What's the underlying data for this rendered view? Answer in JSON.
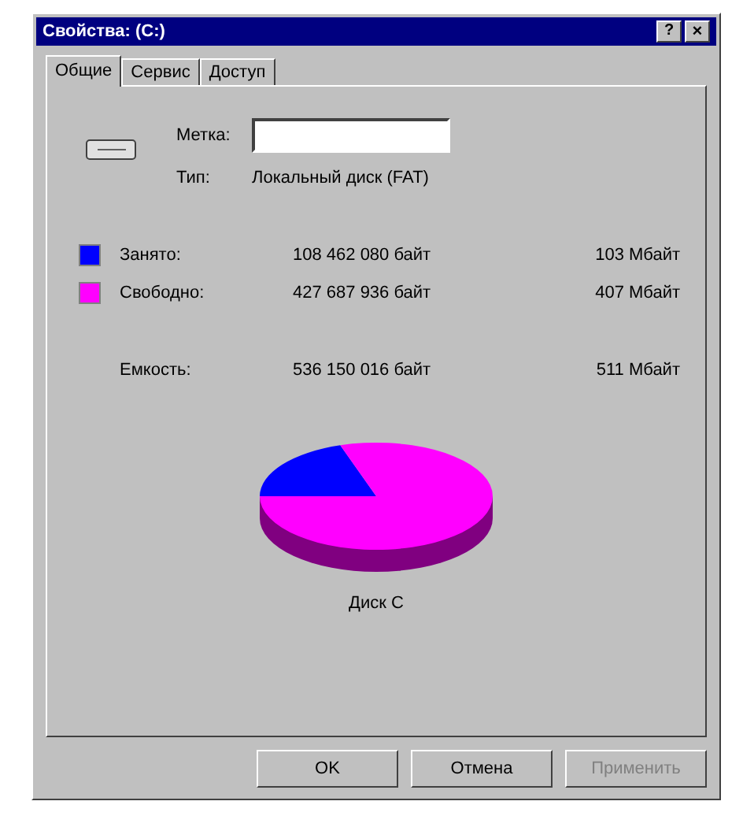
{
  "window": {
    "title": "Свойства: (C:)",
    "help_button": "?",
    "close_button": "×"
  },
  "tabs": [
    {
      "label": "Общие",
      "selected": true
    },
    {
      "label": "Сервис",
      "selected": false
    },
    {
      "label": "Доступ",
      "selected": false
    }
  ],
  "label_field": {
    "label": "Метка:"
  },
  "type": {
    "label": "Тип:",
    "value": "Локальный диск (FAT)"
  },
  "usage": [
    {
      "label": "Занято:",
      "bytes": "108 462 080 байт",
      "mb": "103 Мбайт",
      "color": "#0000ff"
    },
    {
      "label": "Свободно:",
      "bytes": "427 687 936 байт",
      "mb": "407 Мбайт",
      "color": "#ff00ff"
    }
  ],
  "capacity": {
    "label": "Емкость:",
    "bytes": "536 150 016 байт",
    "mb": "511 Мбайт"
  },
  "disk_chart": {
    "title": "Диск C"
  },
  "buttons": [
    {
      "label": "OK",
      "disabled": false
    },
    {
      "label": "Отмена",
      "disabled": false
    },
    {
      "label": "Применить",
      "disabled": true
    }
  ]
}
